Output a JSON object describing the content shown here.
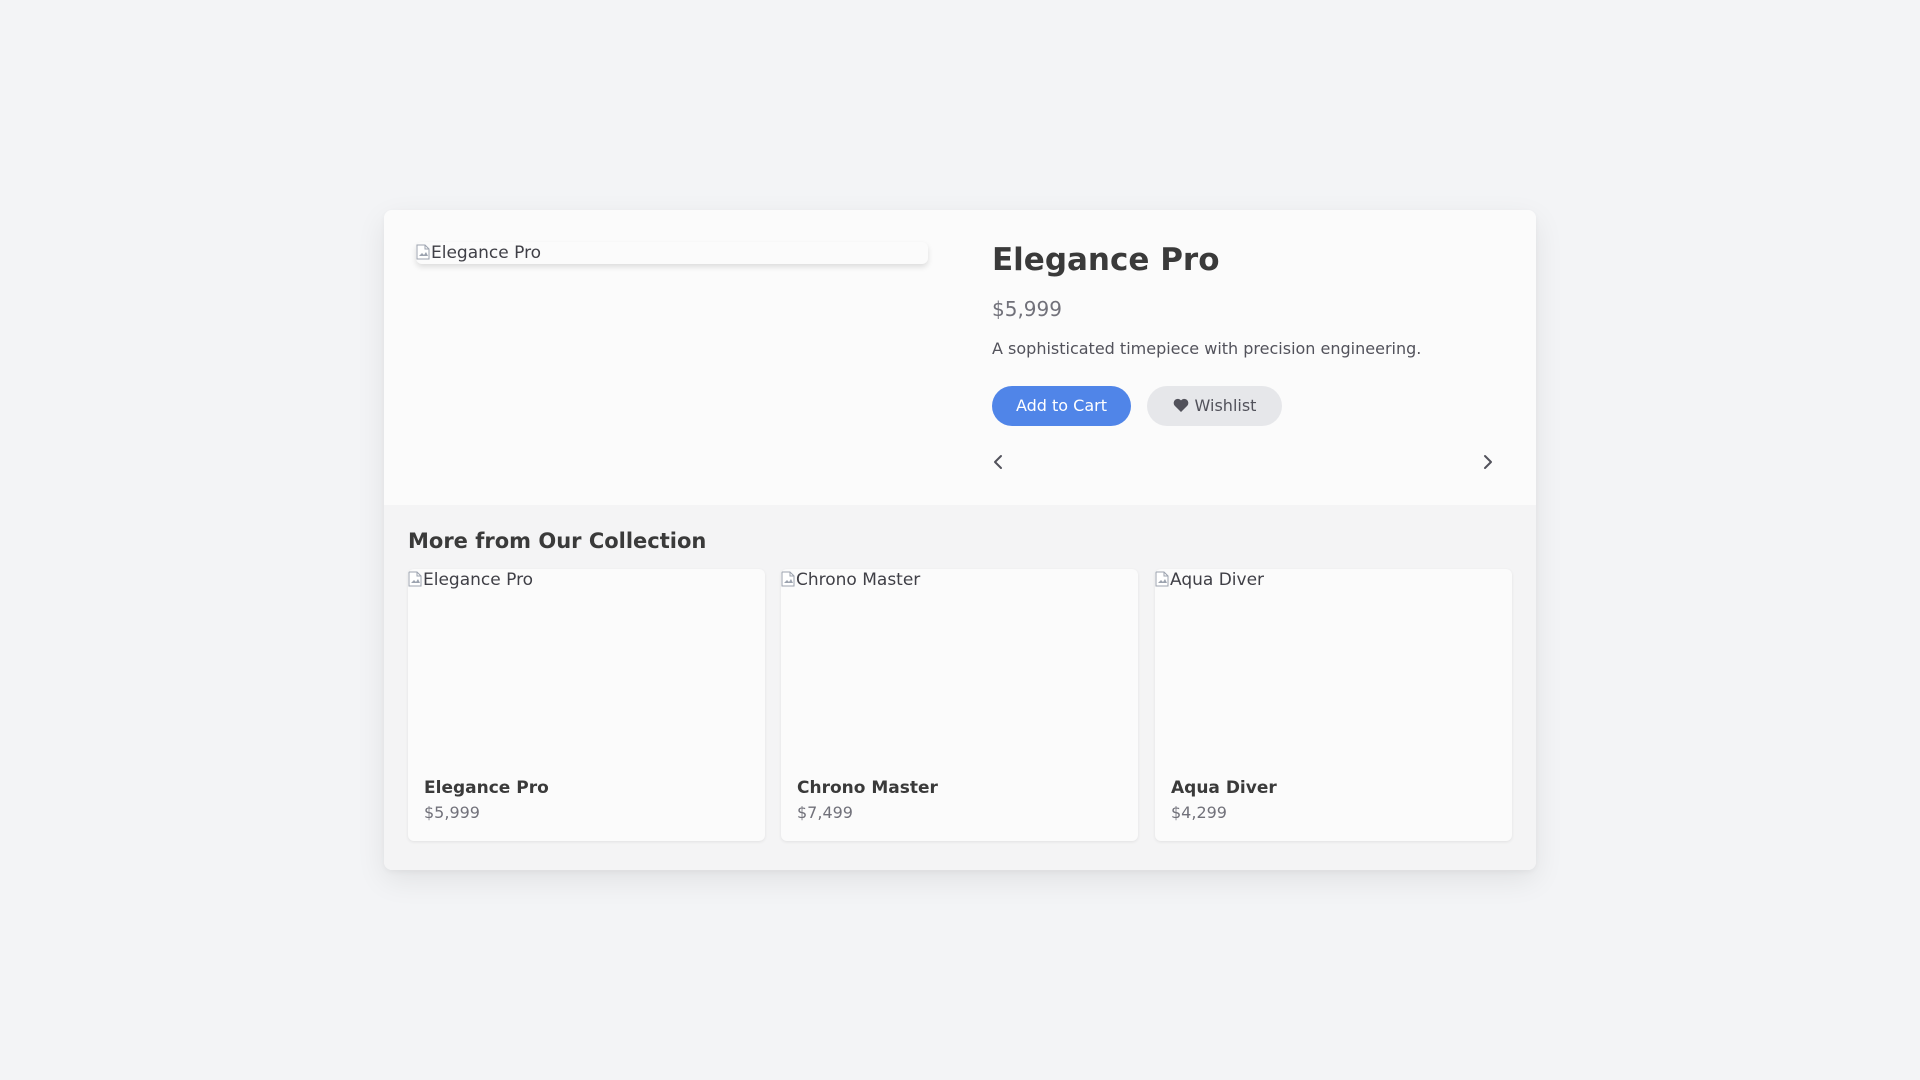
{
  "product": {
    "image_alt": "Elegance Pro",
    "title": "Elegance Pro",
    "price": "$5,999",
    "description": "A sophisticated timepiece with precision engineering.",
    "add_to_cart_label": "Add to Cart",
    "wishlist_label": "Wishlist",
    "wishlist_icon": "heart-icon",
    "prev_icon": "chevron-left-icon",
    "next_icon": "chevron-right-icon"
  },
  "collection": {
    "title": "More from Our Collection",
    "items": [
      {
        "image_alt": "Elegance Pro",
        "name": "Elegance Pro",
        "price": "$5,999"
      },
      {
        "image_alt": "Chrono Master",
        "name": "Chrono Master",
        "price": "$7,499"
      },
      {
        "image_alt": "Aqua Diver",
        "name": "Aqua Diver",
        "price": "$4,299"
      }
    ]
  },
  "colors": {
    "accent": "#5085e8",
    "background": "#f3f4f6",
    "card": "#fafafa",
    "secondary_button": "#e6e7ea"
  }
}
